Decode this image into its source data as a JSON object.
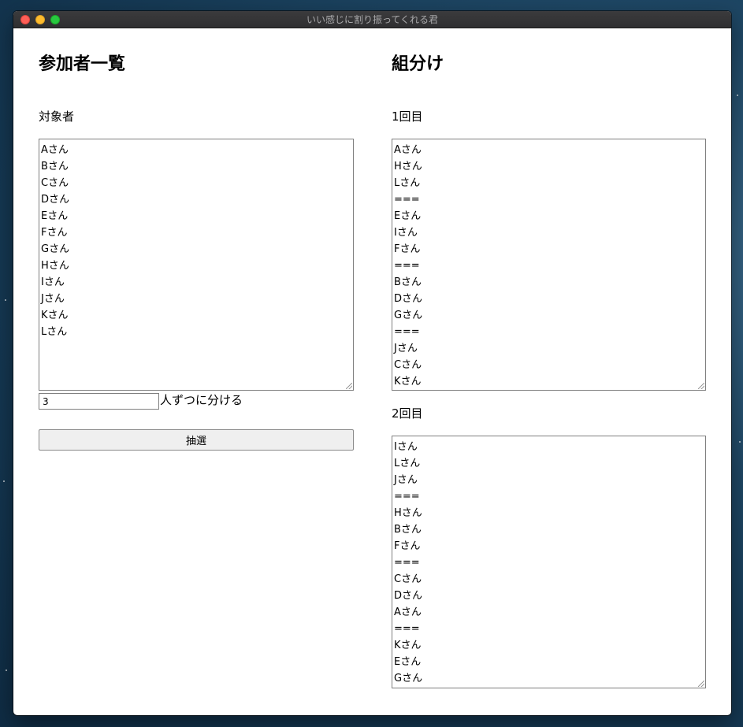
{
  "window": {
    "title": "いい感じに割り振ってくれる君"
  },
  "participants": {
    "heading": "参加者一覧",
    "list_label": "対象者",
    "list_value": "Aさん\nBさん\nCさん\nDさん\nEさん\nFさん\nGさん\nHさん\nIさん\nJさん\nKさん\nLさん",
    "group_size_value": "3",
    "group_size_suffix": "人ずつに分ける",
    "draw_button_label": "抽選"
  },
  "grouping": {
    "heading": "組分け",
    "rounds": [
      {
        "label": "1回目",
        "value": "Aさん\nHさん\nLさん\n===\nEさん\nIさん\nFさん\n===\nBさん\nDさん\nGさん\n===\nJさん\nCさん\nKさん"
      },
      {
        "label": "2回目",
        "value": "Iさん\nLさん\nJさん\n===\nHさん\nBさん\nFさん\n===\nCさん\nDさん\nAさん\n===\nKさん\nEさん\nGさん"
      }
    ]
  },
  "colors": {
    "close": "#fe5f57",
    "minimize": "#febc2e",
    "zoom": "#28c840",
    "titlebar": "#353537",
    "button_bg": "#efefef"
  }
}
